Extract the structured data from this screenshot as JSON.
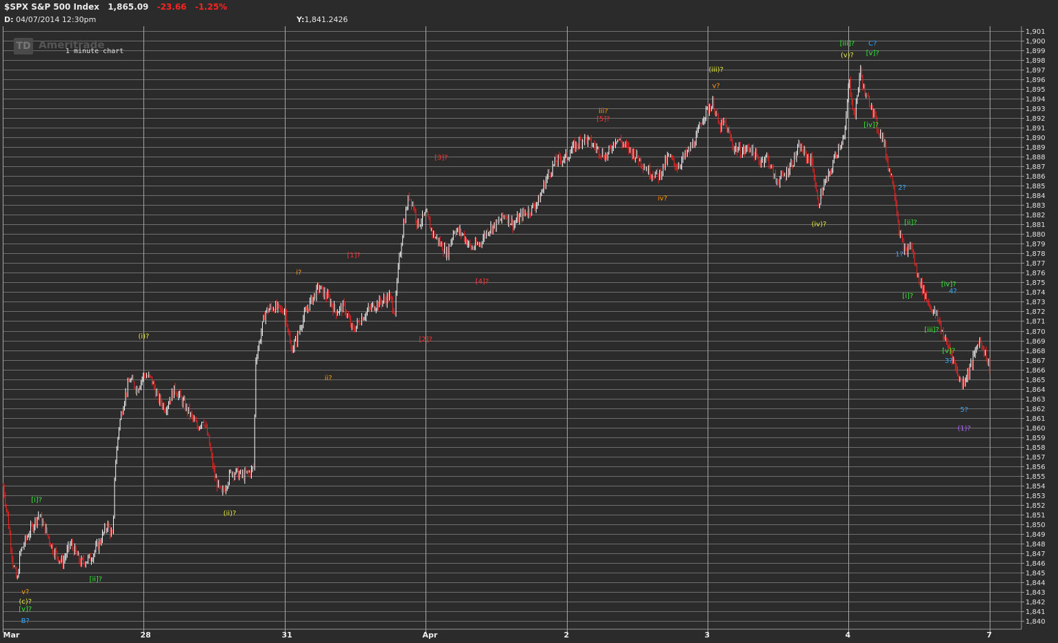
{
  "header": {
    "symbol": "$SPX S&P 500 Index",
    "last": "1,865.09",
    "change": "-23.66",
    "change_pct": "-1.25%",
    "date_prefix": "D:",
    "datetime": "04/07/2014  12:30pm",
    "y_prefix": "Y:",
    "y_value": "1,841.2426"
  },
  "watermark": {
    "logo": "TD",
    "brand": "Ameritrade"
  },
  "colors": {
    "background": "#2b2b2b",
    "grid": "#777777",
    "up_bar": "#ffffff",
    "down_bar": "#ff2020"
  },
  "chart_data": {
    "type": "bar",
    "subtitle": "1 minute chart",
    "ylim": [
      1840,
      1901
    ],
    "grid": true,
    "x_labels": [
      {
        "label": "Mar",
        "x": 0
      },
      {
        "label": "28",
        "x": 1
      },
      {
        "label": "31",
        "x": 2
      },
      {
        "label": "Apr",
        "x": 3
      },
      {
        "label": "2",
        "x": 4
      },
      {
        "label": "3",
        "x": 5
      },
      {
        "label": "4",
        "x": 6
      },
      {
        "label": "7",
        "x": 7
      }
    ],
    "price_path": [
      [
        0.0,
        1854.0
      ],
      [
        0.03,
        1851.0
      ],
      [
        0.07,
        1846.0
      ],
      [
        0.1,
        1844.0
      ],
      [
        0.12,
        1847.0
      ],
      [
        0.18,
        1849.0
      ],
      [
        0.25,
        1851.0
      ],
      [
        0.3,
        1849.5
      ],
      [
        0.35,
        1847.5
      ],
      [
        0.42,
        1846.0
      ],
      [
        0.48,
        1848.0
      ],
      [
        0.55,
        1846.0
      ],
      [
        0.62,
        1846.5
      ],
      [
        0.68,
        1848.0
      ],
      [
        0.74,
        1850.0
      ],
      [
        0.78,
        1848.5
      ],
      [
        0.79,
        1855.0
      ],
      [
        0.82,
        1860.0
      ],
      [
        0.86,
        1863.0
      ],
      [
        0.9,
        1865.0
      ],
      [
        0.95,
        1864.0
      ],
      [
        1.0,
        1865.5
      ],
      [
        1.05,
        1865.0
      ],
      [
        1.1,
        1863.0
      ],
      [
        1.15,
        1862.0
      ],
      [
        1.22,
        1864.0
      ],
      [
        1.3,
        1862.0
      ],
      [
        1.38,
        1860.0
      ],
      [
        1.42,
        1861.0
      ],
      [
        1.46,
        1858.5
      ],
      [
        1.5,
        1855.0
      ],
      [
        1.55,
        1853.0
      ],
      [
        1.62,
        1855.5
      ],
      [
        1.7,
        1855.0
      ],
      [
        1.76,
        1855.5
      ],
      [
        1.78,
        1856.0
      ],
      [
        1.79,
        1867.0
      ],
      [
        1.82,
        1869.0
      ],
      [
        1.86,
        1872.0
      ],
      [
        1.92,
        1872.5
      ],
      [
        1.98,
        1872.0
      ],
      [
        2.0,
        1872.5
      ],
      [
        2.04,
        1868.0
      ],
      [
        2.08,
        1869.0
      ],
      [
        2.12,
        1871.0
      ],
      [
        2.18,
        1873.0
      ],
      [
        2.24,
        1874.5
      ],
      [
        2.3,
        1873.5
      ],
      [
        2.36,
        1872.0
      ],
      [
        2.42,
        1872.5
      ],
      [
        2.48,
        1870.0
      ],
      [
        2.55,
        1871.5
      ],
      [
        2.62,
        1872.5
      ],
      [
        2.68,
        1873.0
      ],
      [
        2.74,
        1873.5
      ],
      [
        2.78,
        1872.0
      ],
      [
        2.8,
        1876.0
      ],
      [
        2.84,
        1881.0
      ],
      [
        2.88,
        1884.0
      ],
      [
        2.91,
        1883.0
      ],
      [
        2.94,
        1881.0
      ],
      [
        3.0,
        1882.0
      ],
      [
        3.05,
        1880.0
      ],
      [
        3.1,
        1879.0
      ],
      [
        3.15,
        1878.0
      ],
      [
        3.2,
        1880.5
      ],
      [
        3.26,
        1880.0
      ],
      [
        3.32,
        1878.5
      ],
      [
        3.38,
        1879.0
      ],
      [
        3.44,
        1880.5
      ],
      [
        3.5,
        1881.0
      ],
      [
        3.56,
        1882.0
      ],
      [
        3.62,
        1881.0
      ],
      [
        3.68,
        1882.0
      ],
      [
        3.74,
        1882.5
      ],
      [
        3.8,
        1883.5
      ],
      [
        3.86,
        1886.0
      ],
      [
        3.92,
        1887.5
      ],
      [
        4.0,
        1888.0
      ],
      [
        4.05,
        1889.0
      ],
      [
        4.12,
        1890.0
      ],
      [
        4.2,
        1889.0
      ],
      [
        4.28,
        1888.0
      ],
      [
        4.35,
        1890.0
      ],
      [
        4.42,
        1889.0
      ],
      [
        4.5,
        1888.0
      ],
      [
        4.58,
        1886.5
      ],
      [
        4.65,
        1886.0
      ],
      [
        4.72,
        1888.0
      ],
      [
        4.78,
        1887.0
      ],
      [
        4.86,
        1888.5
      ],
      [
        4.92,
        1890.0
      ],
      [
        4.96,
        1892.0
      ],
      [
        5.0,
        1893.0
      ],
      [
        5.04,
        1893.5
      ],
      [
        5.08,
        1891.0
      ],
      [
        5.12,
        1891.5
      ],
      [
        5.18,
        1889.0
      ],
      [
        5.24,
        1888.5
      ],
      [
        5.3,
        1889.0
      ],
      [
        5.36,
        1887.5
      ],
      [
        5.42,
        1888.0
      ],
      [
        5.48,
        1885.5
      ],
      [
        5.54,
        1886.0
      ],
      [
        5.6,
        1887.5
      ],
      [
        5.65,
        1889.0
      ],
      [
        5.7,
        1888.0
      ],
      [
        5.74,
        1887.5
      ],
      [
        5.78,
        1883.0
      ],
      [
        5.82,
        1885.0
      ],
      [
        5.86,
        1886.0
      ],
      [
        5.9,
        1888.0
      ],
      [
        5.94,
        1889.5
      ],
      [
        5.97,
        1890.0
      ],
      [
        6.0,
        1896.0
      ],
      [
        6.04,
        1892.0
      ],
      [
        6.08,
        1897.0
      ],
      [
        6.12,
        1894.0
      ],
      [
        6.16,
        1893.5
      ],
      [
        6.2,
        1891.0
      ],
      [
        6.24,
        1890.0
      ],
      [
        6.28,
        1887.0
      ],
      [
        6.32,
        1885.0
      ],
      [
        6.36,
        1880.0
      ],
      [
        6.4,
        1878.0
      ],
      [
        6.44,
        1879.0
      ],
      [
        6.48,
        1876.0
      ],
      [
        6.52,
        1874.5
      ],
      [
        6.56,
        1873.0
      ],
      [
        6.6,
        1872.0
      ],
      [
        6.64,
        1871.0
      ],
      [
        6.68,
        1869.0
      ],
      [
        6.72,
        1868.0
      ],
      [
        6.76,
        1866.0
      ],
      [
        6.8,
        1864.5
      ],
      [
        6.84,
        1865.5
      ],
      [
        6.88,
        1867.0
      ],
      [
        6.92,
        1869.0
      ],
      [
        6.95,
        1868.5
      ],
      [
        6.97,
        1867.5
      ],
      [
        7.0,
        1866.0
      ]
    ],
    "wave_labels": [
      {
        "text": "v?",
        "x": 0.16,
        "y": 1842.8,
        "color": "#ff9900"
      },
      {
        "text": "(c)?",
        "x": 0.16,
        "y": 1841.8,
        "color": "#e8e840"
      },
      {
        "text": "[v]?",
        "x": 0.16,
        "y": 1841.0,
        "color": "#33ee33"
      },
      {
        "text": "B?",
        "x": 0.16,
        "y": 1839.8,
        "color": "#33a8ff"
      },
      {
        "text": "[i]?",
        "x": 0.24,
        "y": 1852.3,
        "color": "#33ee33"
      },
      {
        "text": "[ii]?",
        "x": 0.66,
        "y": 1844.1,
        "color": "#33ee33"
      },
      {
        "text": "(i)?",
        "x": 1.0,
        "y": 1869.2,
        "color": "#e8e840"
      },
      {
        "text": "(ii)?",
        "x": 1.61,
        "y": 1850.9,
        "color": "#e8e840"
      },
      {
        "text": "i?",
        "x": 2.1,
        "y": 1875.8,
        "color": "#ff9900"
      },
      {
        "text": "ii?",
        "x": 2.31,
        "y": 1864.9,
        "color": "#ff9900"
      },
      {
        "text": "[1]?",
        "x": 2.49,
        "y": 1877.6,
        "color": "#ff3333"
      },
      {
        "text": "[2]?",
        "x": 3.0,
        "y": 1868.9,
        "color": "#ff3333"
      },
      {
        "text": "[3]?",
        "x": 3.11,
        "y": 1887.7,
        "color": "#ff3333"
      },
      {
        "text": "[4]?",
        "x": 3.4,
        "y": 1874.9,
        "color": "#ff3333"
      },
      {
        "text": "iii?",
        "x": 4.26,
        "y": 1892.5,
        "color": "#ff9900"
      },
      {
        "text": "[5]?",
        "x": 4.26,
        "y": 1891.7,
        "color": "#ff3333"
      },
      {
        "text": "iv?",
        "x": 4.68,
        "y": 1883.5,
        "color": "#ff9900"
      },
      {
        "text": "(iii)?",
        "x": 5.06,
        "y": 1896.8,
        "color": "#e8e840"
      },
      {
        "text": "v?",
        "x": 5.06,
        "y": 1895.1,
        "color": "#ff9900"
      },
      {
        "text": "(iv)?",
        "x": 5.79,
        "y": 1880.8,
        "color": "#e8e840"
      },
      {
        "text": "[iii]?",
        "x": 5.99,
        "y": 1899.5,
        "color": "#33ee33"
      },
      {
        "text": "(v)?",
        "x": 5.99,
        "y": 1898.3,
        "color": "#e8e840"
      },
      {
        "text": "C?",
        "x": 6.17,
        "y": 1899.5,
        "color": "#33a8ff"
      },
      {
        "text": "[v]?",
        "x": 6.17,
        "y": 1898.5,
        "color": "#33ee33"
      },
      {
        "text": "[iv]?",
        "x": 6.16,
        "y": 1891.1,
        "color": "#33ee33"
      },
      {
        "text": "2?",
        "x": 6.38,
        "y": 1884.6,
        "color": "#33a8ff"
      },
      {
        "text": "[ii]?",
        "x": 6.44,
        "y": 1881.0,
        "color": "#33ee33"
      },
      {
        "text": "1?",
        "x": 6.36,
        "y": 1877.7,
        "color": "#33a8ff"
      },
      {
        "text": "[i]?",
        "x": 6.42,
        "y": 1873.4,
        "color": "#33ee33"
      },
      {
        "text": "[iv]?",
        "x": 6.71,
        "y": 1874.6,
        "color": "#33ee33"
      },
      {
        "text": "4?",
        "x": 6.74,
        "y": 1873.9,
        "color": "#33a8ff"
      },
      {
        "text": "[iii]?",
        "x": 6.59,
        "y": 1869.9,
        "color": "#33ee33"
      },
      {
        "text": "[v]?",
        "x": 6.71,
        "y": 1867.7,
        "color": "#33ee33"
      },
      {
        "text": "3?",
        "x": 6.71,
        "y": 1866.7,
        "color": "#33a8ff"
      },
      {
        "text": "5?",
        "x": 6.82,
        "y": 1861.6,
        "color": "#33a8ff"
      },
      {
        "text": "(1)?",
        "x": 6.82,
        "y": 1859.7,
        "color": "#b060ff"
      }
    ]
  }
}
